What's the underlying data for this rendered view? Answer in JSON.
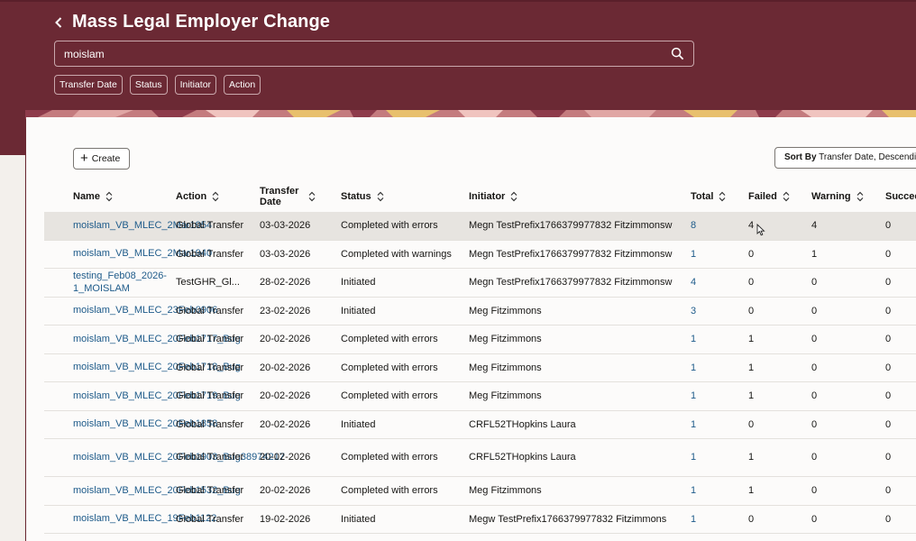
{
  "header": {
    "title": "Mass Legal Employer Change",
    "search_value": "moislam",
    "filters": [
      "Transfer Date",
      "Status",
      "Initiator",
      "Action"
    ]
  },
  "toolbar": {
    "create_label": "Create",
    "sort_prefix": "Sort By",
    "sort_value": "Transfer Date, Descending"
  },
  "table": {
    "columns": [
      "Name",
      "Action",
      "Transfer Date",
      "Status",
      "Initiator",
      "Total",
      "Failed",
      "Warning",
      "Succee"
    ],
    "rows": [
      {
        "name": "moislam_VB_MLEC_2Mar1954",
        "action": "Global Transfer",
        "date": "03-03-2026",
        "status": "Completed with errors",
        "initiator": "Megn TestPrefix1766379977832 Fitzimmonsw",
        "total": "8",
        "failed": "4",
        "warning": "4",
        "succeeded": "0"
      },
      {
        "name": "moislam_VB_MLEC_2Mar1940",
        "action": "Global Transfer",
        "date": "03-03-2026",
        "status": "Completed with warnings",
        "initiator": "Megn TestPrefix1766379977832 Fitzimmonsw",
        "total": "1",
        "failed": "0",
        "warning": "1",
        "succeeded": "0"
      },
      {
        "name": "testing_Feb08_2026-1_MOISLAM",
        "action": "TestGHR_Gl...",
        "date": "28-02-2026",
        "status": "Initiated",
        "initiator": "Megn TestPrefix1766379977832 Fitzimmonsw",
        "total": "4",
        "failed": "0",
        "warning": "0",
        "succeeded": "0"
      },
      {
        "name": "moislam_VB_MLEC_23Feb0906",
        "action": "Global Transfer",
        "date": "23-02-2026",
        "status": "Initiated",
        "initiator": "Meg Fitzimmons",
        "total": "3",
        "failed": "0",
        "warning": "0",
        "succeeded": "0"
      },
      {
        "name": "moislam_VB_MLEC_20Feb1717_Bug",
        "action": "Global Transfer",
        "date": "20-02-2026",
        "status": "Completed with errors",
        "initiator": "Meg Fitzimmons",
        "total": "1",
        "failed": "1",
        "warning": "0",
        "succeeded": "0"
      },
      {
        "name": "moislam_VB_MLEC_20Feb1718_Bug",
        "action": "Global Transfer",
        "date": "20-02-2026",
        "status": "Completed with errors",
        "initiator": "Meg Fitzimmons",
        "total": "1",
        "failed": "1",
        "warning": "0",
        "succeeded": "0"
      },
      {
        "name": "moislam_VB_MLEC_20Feb1719_Bug",
        "action": "Global Transfer",
        "date": "20-02-2026",
        "status": "Completed with errors",
        "initiator": "Meg Fitzimmons",
        "total": "1",
        "failed": "1",
        "warning": "0",
        "succeeded": "0"
      },
      {
        "name": "moislam_VB_MLEC_20Feb1858",
        "action": "Global Transfer",
        "date": "20-02-2026",
        "status": "Initiated",
        "initiator": "CRFL52THopkins Laura",
        "total": "1",
        "failed": "0",
        "warning": "0",
        "succeeded": "0"
      },
      {
        "name": "moislam_VB_MLEC_20Feb1903_Bug38974217",
        "action": "Global Transfer",
        "date": "20-02-2026",
        "status": "Completed with errors",
        "initiator": "CRFL52THopkins Laura",
        "total": "1",
        "failed": "1",
        "warning": "0",
        "succeeded": "0"
      },
      {
        "name": "moislam_VB_MLEC_20Feb1532_Bug",
        "action": "Global Transfer",
        "date": "20-02-2026",
        "status": "Completed with errors",
        "initiator": "Meg Fitzimmons",
        "total": "1",
        "failed": "1",
        "warning": "0",
        "succeeded": "0"
      },
      {
        "name": "moislam_VB_MLEC_19Feb1122",
        "action": "Global Transfer",
        "date": "19-02-2026",
        "status": "Initiated",
        "initiator": "Megw TestPrefix1766379977832 Fitzimmons",
        "total": "1",
        "failed": "0",
        "warning": "0",
        "succeeded": "0"
      }
    ]
  }
}
